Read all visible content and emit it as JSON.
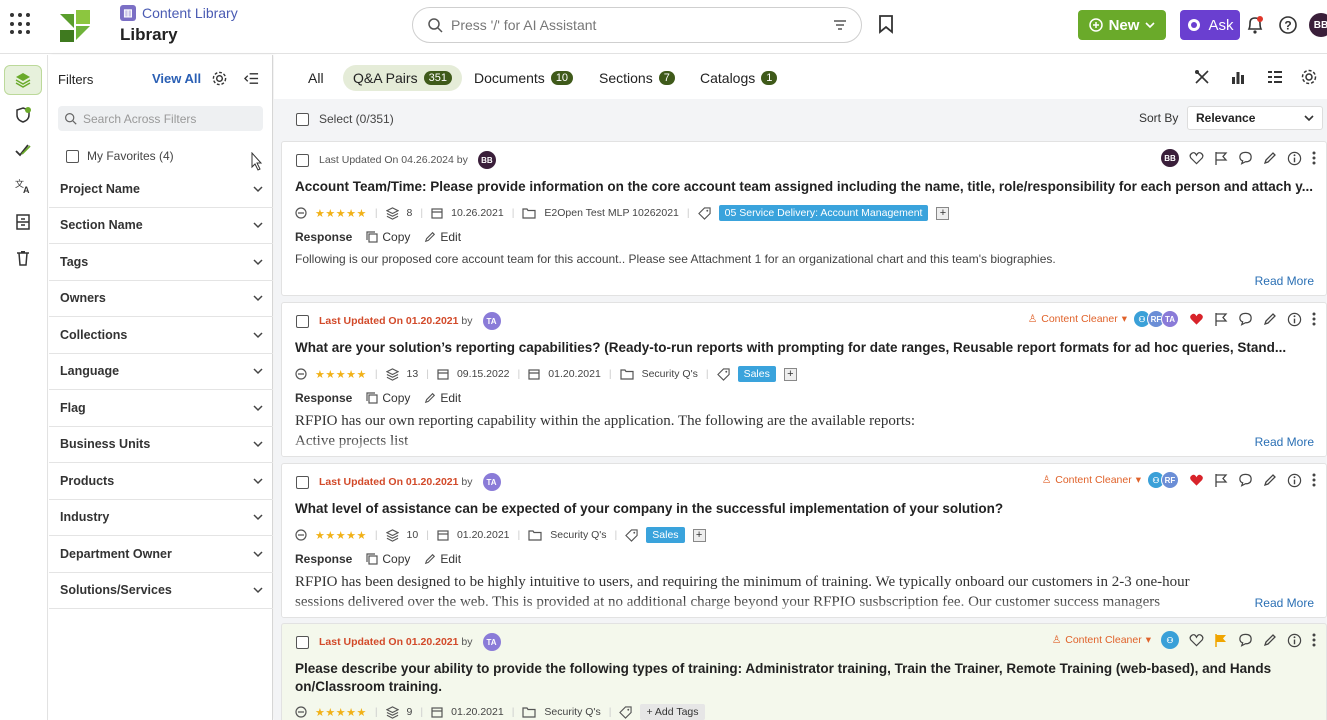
{
  "header": {
    "breadcrumb": "Content Library",
    "title": "Library",
    "search_placeholder": "Press '/' for AI Assistant",
    "new_label": "New",
    "ask_label": "Ask",
    "user_initials": "BB",
    "accent_new": "#6aaa2a",
    "accent_ask": "#6a3fd0"
  },
  "filters": {
    "title": "Filters",
    "view_all": "View All",
    "search_placeholder": "Search Across Filters",
    "favorites": "My Favorites (4)",
    "items": [
      "Project Name",
      "Section Name",
      "Tags",
      "Owners",
      "Collections",
      "Language",
      "Flag",
      "Business Units",
      "Products",
      "Industry",
      "Department Owner",
      "Solutions/Services"
    ]
  },
  "tabs": [
    {
      "label": "All",
      "count": ""
    },
    {
      "label": "Q&A Pairs",
      "count": "351"
    },
    {
      "label": "Documents",
      "count": "10"
    },
    {
      "label": "Sections",
      "count": "7"
    },
    {
      "label": "Catalogs",
      "count": "1"
    }
  ],
  "toolbar": {
    "select_label": "Select (0/351)",
    "sort_label": "Sort By",
    "sort_value": "Relevance"
  },
  "cards": [
    {
      "updated": "Last Updated On 04.26.2024",
      "by": "by",
      "author": "BB",
      "question": "Account Team/Time:  Please provide information on the core account team assigned including the name, title, role/responsibility for each person and attach y...",
      "stars": "★★★★★",
      "versions": "8",
      "date1": "10.26.2021",
      "date2": "",
      "folder": "E2Open Test MLP 10262021",
      "tag": "05 Service Delivery: Account Management",
      "response_label": "Response",
      "copy_label": "Copy",
      "edit_label": "Edit",
      "answer": "Following is our proposed core account team for this account.. Please see Attachment 1 for an organizational chart and this team's biographies.",
      "read_more": "Read More",
      "right_avatars": [
        "BB"
      ]
    },
    {
      "updated": "Last Updated On 01.20.2021",
      "by": "by",
      "author": "TA",
      "cleaner": "Content Cleaner",
      "question": "What are your solution’s reporting capabilities?  (Ready-to-run reports with prompting for date ranges, Reusable report formats for ad hoc queries, Stand...",
      "stars": "★★★★★",
      "versions": "13",
      "date1": "09.15.2022",
      "date2": "01.20.2021",
      "folder": "Security Q's",
      "tag": "Sales",
      "response_label": "Response",
      "copy_label": "Copy",
      "edit_label": "Edit",
      "answer_line1": "RFPIO has our own reporting capability within the application. The following are the available reports:",
      "answer_line2": "Active projects list",
      "read_more": "Read More",
      "right_avatars": [
        "RF",
        "TA"
      ]
    },
    {
      "updated": "Last Updated On 01.20.2021",
      "by": "by",
      "author": "TA",
      "cleaner": "Content Cleaner",
      "question": "What level of assistance can be expected of your company in the successful implementation of your solution?",
      "stars": "★★★★★",
      "versions": "10",
      "date1": "01.20.2021",
      "folder": "Security Q's",
      "tag": "Sales",
      "response_label": "Response",
      "copy_label": "Copy",
      "edit_label": "Edit",
      "answer_line1": "RFPIO has been designed to be highly intuitive to users, and requiring the minimum of training. We typically onboard our customers in 2-3 one-hour",
      "answer_line2": "sessions delivered over the web. This is provided at no additional charge beyond your RFPIO susbscription fee. Our customer success managers",
      "read_more": "Read More",
      "right_avatars": [
        "RF"
      ]
    },
    {
      "updated": "Last Updated On 01.20.2021",
      "by": "by",
      "author": "TA",
      "cleaner": "Content Cleaner",
      "question": "Please describe your ability to provide the following types of training:  Administrator training, Train the Trainer, Remote Training (web-based), and Hands on/Classroom training.",
      "stars": "★★★★★",
      "versions": "9",
      "date1": "01.20.2021",
      "folder": "Security Q's",
      "add_tags": "+ Add Tags"
    }
  ]
}
